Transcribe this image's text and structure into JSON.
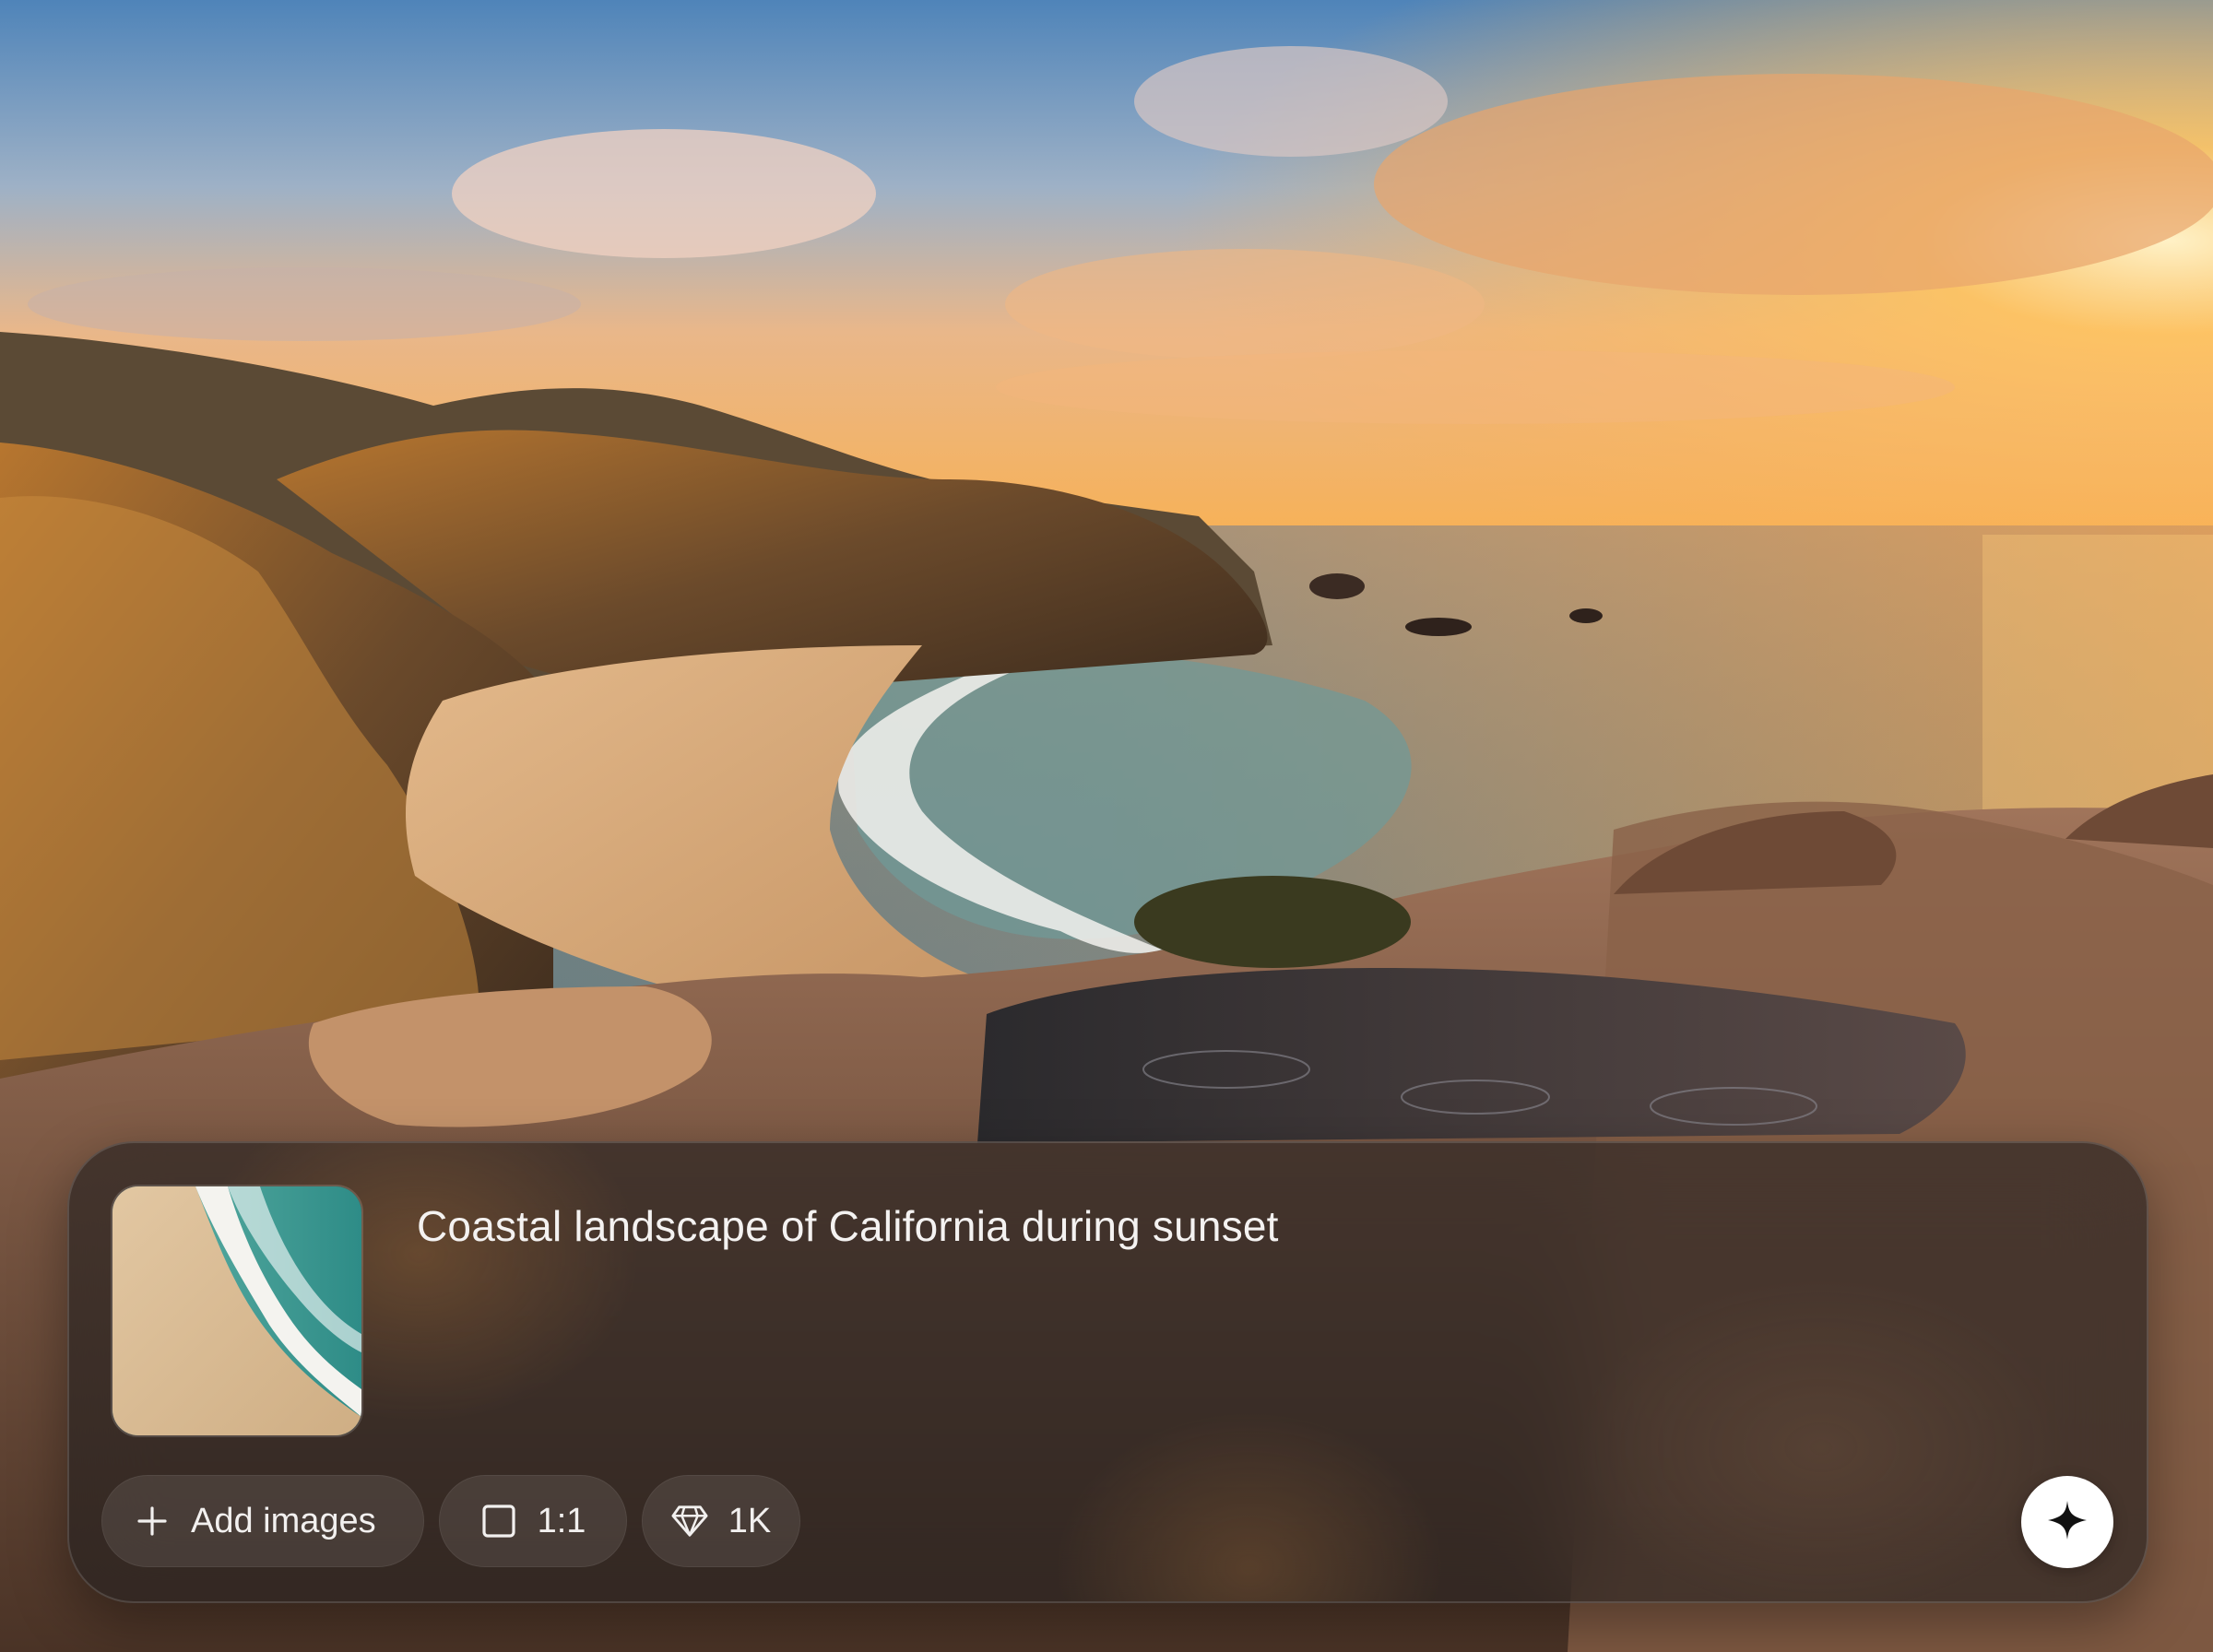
{
  "composer": {
    "prompt": "Coastal landscape of California during sunset",
    "thumbnail_icon": "beach-aerial-image",
    "chips": {
      "add_images_label": "Add images",
      "add_images_icon": "plus-icon",
      "aspect_ratio_label": "1:1",
      "aspect_ratio_icon": "square-icon",
      "quality_label": "1K",
      "quality_icon": "diamond-icon"
    },
    "generate_icon": "sparkle-icon"
  },
  "colors": {
    "card_background": "#221e1e",
    "chip_background": "#3a3433",
    "generate_button": "#ffffff",
    "text": "#f4f2f1"
  }
}
